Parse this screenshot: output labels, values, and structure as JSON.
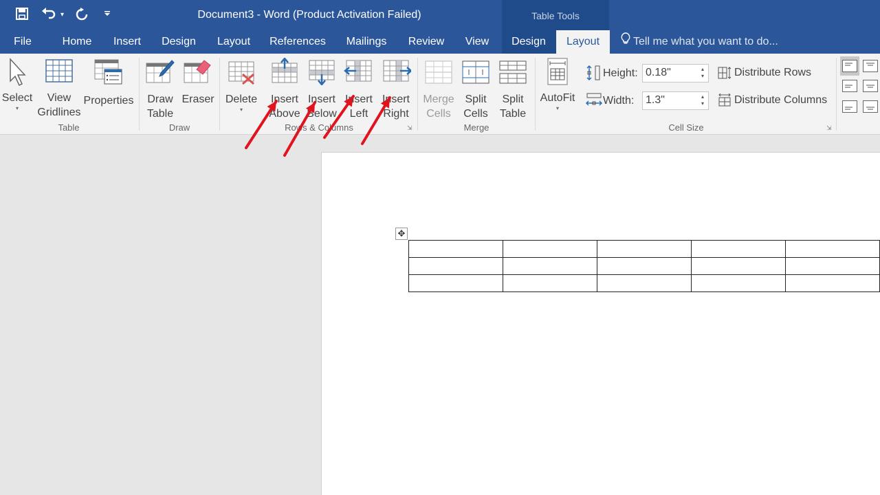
{
  "window": {
    "title": "Document3 - Word (Product Activation Failed)",
    "context_group": "Table Tools"
  },
  "quick_access": {
    "save_icon": "save-icon",
    "undo_icon": "undo-icon",
    "undo_dropdown": "▾",
    "redo_icon": "repeat-icon",
    "customize_icon": "customize-qat-icon"
  },
  "tabs": [
    {
      "label": "File"
    },
    {
      "label": "Home"
    },
    {
      "label": "Insert"
    },
    {
      "label": "Design"
    },
    {
      "label": "Layout"
    },
    {
      "label": "References"
    },
    {
      "label": "Mailings"
    },
    {
      "label": "Review"
    },
    {
      "label": "View"
    },
    {
      "label": "Design"
    },
    {
      "label": "Layout",
      "active": true
    }
  ],
  "tell_me": {
    "placeholder": "Tell me what you want to do..."
  },
  "ribbon": {
    "groups": {
      "table": {
        "label": "Table"
      },
      "draw": {
        "label": "Draw"
      },
      "rows_columns": {
        "label": "Rows & Columns"
      },
      "merge": {
        "label": "Merge"
      },
      "cell_size": {
        "label": "Cell Size"
      }
    },
    "buttons": {
      "select": {
        "line1": "Select",
        "dropdown": "▾"
      },
      "view_gridlines": {
        "line1": "View",
        "line2": "Gridlines"
      },
      "properties": {
        "line1": "Properties"
      },
      "draw_table": {
        "line1": "Draw",
        "line2": "Table"
      },
      "eraser": {
        "line1": "Eraser"
      },
      "delete": {
        "line1": "Delete",
        "dropdown": "▾"
      },
      "insert_above": {
        "line1": "Insert",
        "line2": "Above"
      },
      "insert_below": {
        "line1": "Insert",
        "line2": "Below"
      },
      "insert_left": {
        "line1": "Insert",
        "line2": "Left"
      },
      "insert_right": {
        "line1": "Insert",
        "line2": "Right"
      },
      "merge_cells": {
        "line1": "Merge",
        "line2": "Cells",
        "disabled": true
      },
      "split_cells": {
        "line1": "Split",
        "line2": "Cells"
      },
      "split_table": {
        "line1": "Split",
        "line2": "Table"
      },
      "autofit": {
        "line1": "AutoFit",
        "dropdown": "▾"
      },
      "distribute_rows": {
        "label": "Distribute Rows"
      },
      "distribute_columns": {
        "label": "Distribute Columns"
      }
    },
    "cell_size": {
      "height_label": "Height:",
      "height_value": "0.18\"",
      "width_label": "Width:",
      "width_value": "1.3\""
    },
    "spin_up": "▴",
    "spin_down": "▾",
    "launcher": "⇲"
  },
  "document": {
    "move_handle": "✥",
    "table": {
      "rows": 3,
      "columns": 5,
      "cells": [
        [
          "",
          "",
          "",
          "",
          ""
        ],
        [
          "",
          "",
          "",
          "",
          ""
        ],
        [
          "",
          "",
          "",
          "",
          ""
        ]
      ]
    }
  },
  "annotations": {
    "arrow_color": "#e0141e",
    "arrow_targets": [
      "Insert Above",
      "Insert Below",
      "Insert Left",
      "Insert Right"
    ]
  },
  "colors": {
    "title_bar": "#2b579a",
    "context_band": "#1f4b8b",
    "ribbon_bg": "#f3f3f3",
    "workspace_bg": "#e6e6e6"
  }
}
